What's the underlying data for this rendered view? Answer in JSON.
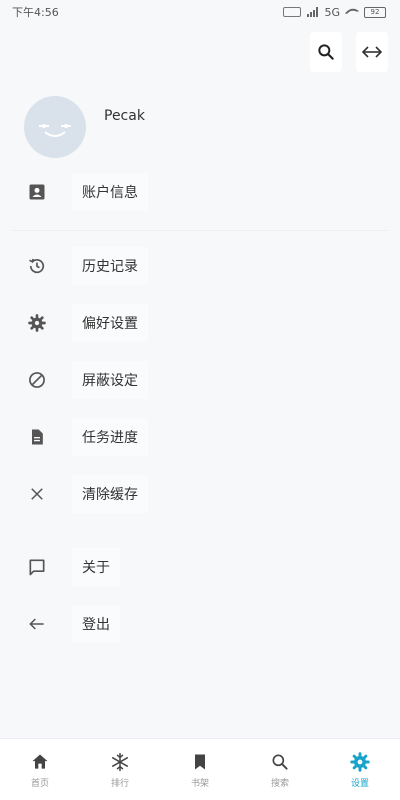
{
  "status_bar": {
    "time": "下午4:56",
    "signal": "5G",
    "battery": "92"
  },
  "user": {
    "name": "Pecak"
  },
  "menu": [
    {
      "id": "account",
      "label": "账户信息",
      "icon": "account-box-icon"
    },
    {
      "id": "history",
      "label": "历史记录",
      "icon": "history-icon"
    },
    {
      "id": "preferences",
      "label": "偏好设置",
      "icon": "gear-icon"
    },
    {
      "id": "block",
      "label": "屏蔽设定",
      "icon": "block-icon"
    },
    {
      "id": "tasks",
      "label": "任务进度",
      "icon": "document-icon"
    },
    {
      "id": "cache",
      "label": "清除缓存",
      "icon": "close-icon"
    },
    {
      "id": "about",
      "label": "关于",
      "icon": "chat-icon"
    },
    {
      "id": "logout",
      "label": "登出",
      "icon": "arrow-left-icon"
    }
  ],
  "nav": [
    {
      "label": "首页",
      "icon": "home-icon"
    },
    {
      "label": "排行",
      "icon": "snowflake-icon"
    },
    {
      "label": "书架",
      "icon": "bookmark-icon"
    },
    {
      "label": "搜索",
      "icon": "search-icon"
    },
    {
      "label": "设置",
      "icon": "gear-icon",
      "active": true
    }
  ],
  "colors": {
    "accent": "#1aa3c8",
    "icon": "#555555",
    "background": "#f7f8fa"
  }
}
